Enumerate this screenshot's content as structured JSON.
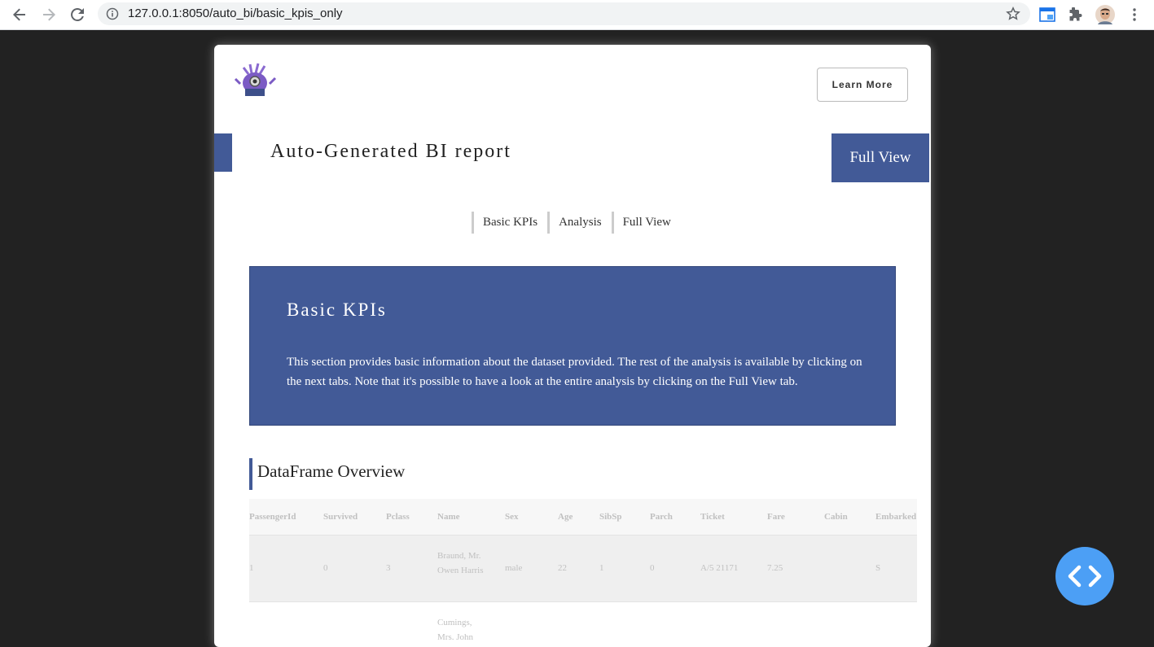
{
  "browser": {
    "url": "127.0.0.1:8050/auto_bi/basic_kpis_only"
  },
  "header": {
    "learn_more_label": "Learn More",
    "report_title": "Auto-Generated BI report",
    "full_view_label": "Full View"
  },
  "tabs": [
    {
      "label": "Basic KPIs"
    },
    {
      "label": "Analysis"
    },
    {
      "label": "Full View"
    }
  ],
  "kpi_section": {
    "title": "Basic KPIs",
    "description": "This section provides basic information about the dataset provided. The rest of the analysis is available by clicking on the next tabs. Note that it's possible to have a look at the entire analysis by clicking on the Full View tab."
  },
  "dataframe": {
    "title": "DataFrame Overview",
    "columns": [
      "PassengerId",
      "Survived",
      "Pclass",
      "Name",
      "Sex",
      "Age",
      "SibSp",
      "Parch",
      "Ticket",
      "Fare",
      "Cabin",
      "Embarked"
    ],
    "rows": [
      {
        "PassengerId": "1",
        "Survived": "0",
        "Pclass": "3",
        "Name": "Braund, Mr. Owen Harris",
        "Sex": "male",
        "Age": "22",
        "SibSp": "1",
        "Parch": "0",
        "Ticket": "A/5 21171",
        "Fare": "7.25",
        "Cabin": "",
        "Embarked": "S"
      },
      {
        "Name": "Cumings, Mrs. John"
      }
    ]
  },
  "colors": {
    "accent": "#425a97",
    "fab": "#4c9ff5"
  }
}
